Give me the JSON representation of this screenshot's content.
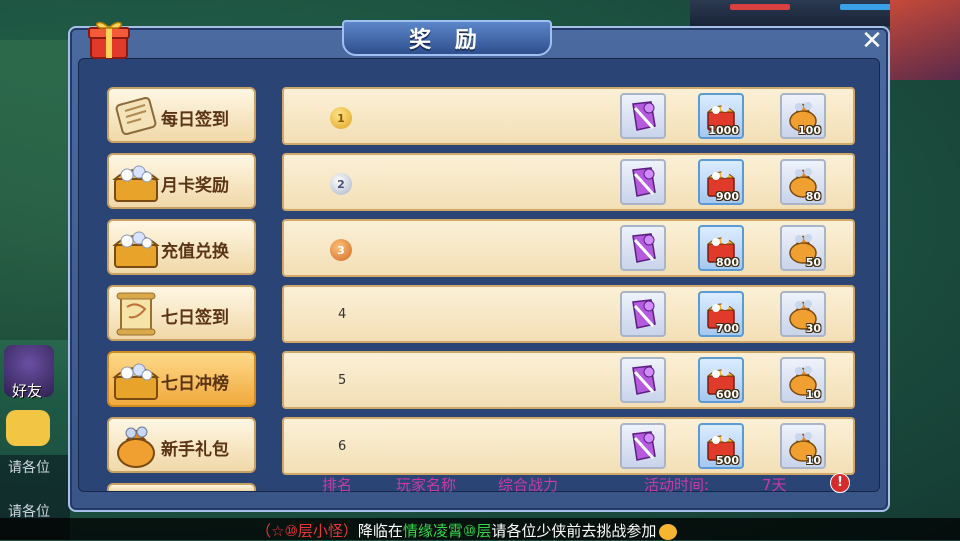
{
  "dialog": {
    "title": "奖 励",
    "close_symbol": "✕"
  },
  "sidebar": {
    "items": [
      {
        "label": "每日签到",
        "icon": "scroll-icon"
      },
      {
        "label": "月卡奖励",
        "icon": "treasure-chest-icon"
      },
      {
        "label": "充值兑换",
        "icon": "treasure-chest-icon"
      },
      {
        "label": "七日签到",
        "icon": "map-scroll-icon"
      },
      {
        "label": "七日冲榜",
        "icon": "treasure-chest-icon",
        "active": true
      },
      {
        "label": "新手礼包",
        "icon": "money-bag-icon"
      }
    ]
  },
  "ranks": [
    {
      "rank": "1",
      "medal": "gold",
      "rewards": [
        "",
        "1000",
        "100"
      ]
    },
    {
      "rank": "2",
      "medal": "silver",
      "rewards": [
        "",
        "900",
        "80"
      ]
    },
    {
      "rank": "3",
      "medal": "bronze",
      "rewards": [
        "",
        "800",
        "50"
      ]
    },
    {
      "rank": "4",
      "medal": "",
      "rewards": [
        "",
        "700",
        "30"
      ]
    },
    {
      "rank": "5",
      "medal": "",
      "rewards": [
        "",
        "600",
        "10"
      ]
    },
    {
      "rank": "6",
      "medal": "",
      "rewards": [
        "",
        "500",
        "10"
      ]
    }
  ],
  "footer": {
    "col_rank": "排名",
    "col_player": "玩家名称",
    "col_power": "综合战力",
    "activity_label": "活动时间:",
    "activity_value": "7天",
    "alert_symbol": "!"
  },
  "background": {
    "friend_label": "好友",
    "chat1": "请各位",
    "chat2": "请各位"
  },
  "broadcast": {
    "part1": "（☆⑩层小怪）",
    "part2": "降临在",
    "part3": "情缘凌霄⑩层",
    "part4": "请各位少侠前去挑战参加"
  },
  "colors": {
    "dialog_bg": "#3a5588",
    "row_bg": "#f3dfb6",
    "footer_text": "#c83aa8",
    "accent_orange": "#f0a93c"
  }
}
